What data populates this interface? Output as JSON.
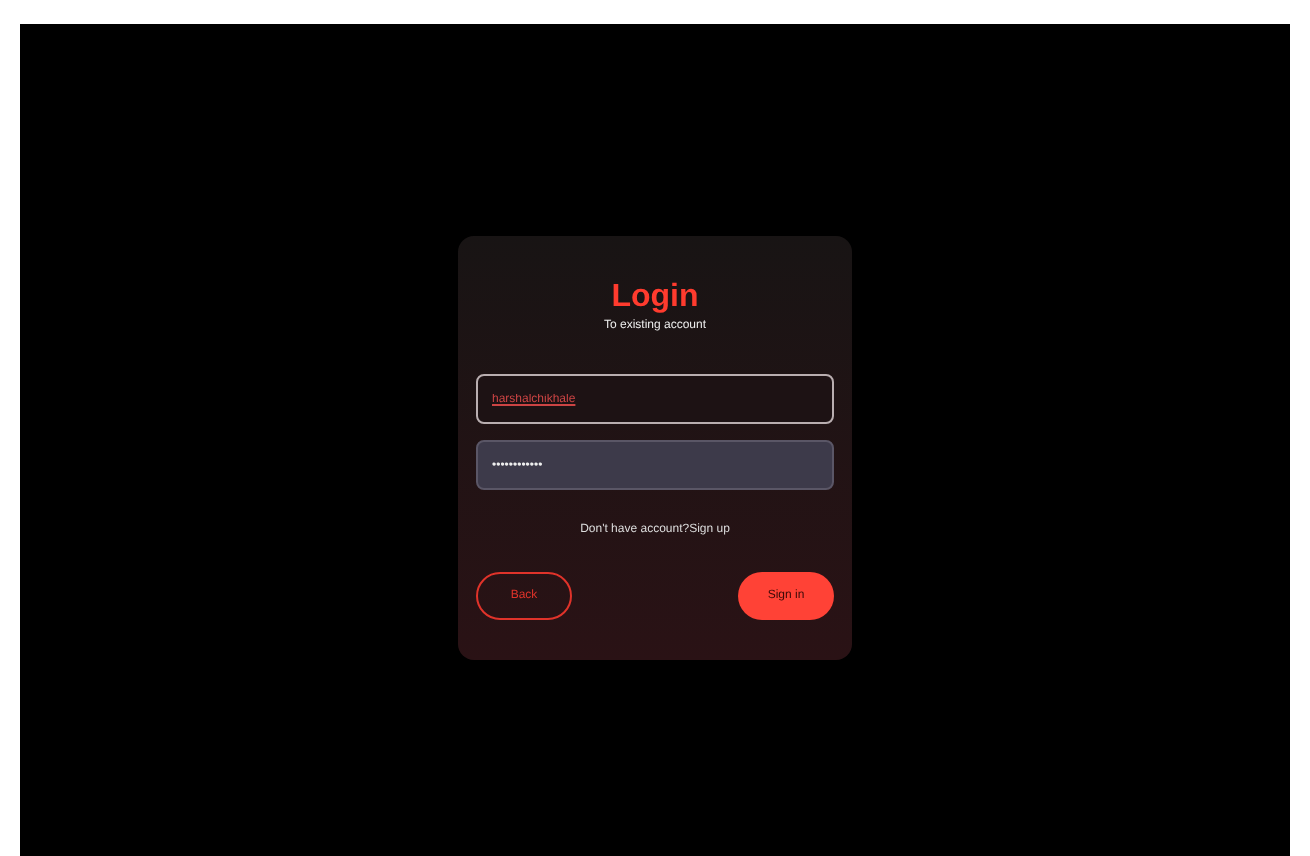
{
  "login": {
    "title": "Login",
    "subtitle": "To existing account",
    "username": {
      "value": "harshalchikhale"
    },
    "password": {
      "value": "••••••••••••"
    },
    "signup_prompt": "Don't have account?",
    "signup_link": "Sign up",
    "buttons": [
      {
        "kind": "outline",
        "label": "Back"
      },
      {
        "kind": "filled",
        "label": "Sign in"
      }
    ]
  }
}
